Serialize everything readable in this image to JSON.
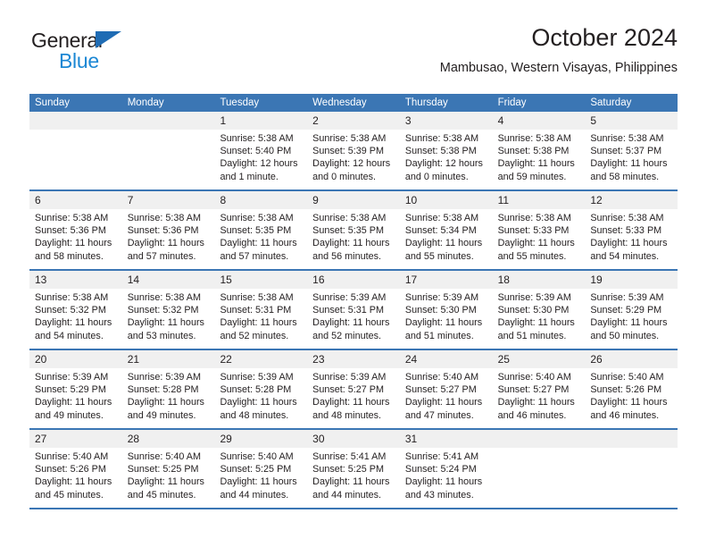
{
  "logo": {
    "word_general": "General",
    "word_blue": "Blue",
    "triangle_color": "#1f6cb4",
    "blue_color": "#1b87d4"
  },
  "header": {
    "title": "October 2024",
    "subtitle": "Mambusao, Western Visayas, Philippines"
  },
  "calendar": {
    "header_bg": "#3b76b4",
    "header_text_color": "#ffffff",
    "daynum_bg": "#f0f0f0",
    "weekdays": [
      "Sunday",
      "Monday",
      "Tuesday",
      "Wednesday",
      "Thursday",
      "Friday",
      "Saturday"
    ],
    "weeks": [
      [
        {
          "day": "",
          "lines": []
        },
        {
          "day": "",
          "lines": []
        },
        {
          "day": "1",
          "lines": [
            "Sunrise: 5:38 AM",
            "Sunset: 5:40 PM",
            "Daylight: 12 hours",
            "and 1 minute."
          ]
        },
        {
          "day": "2",
          "lines": [
            "Sunrise: 5:38 AM",
            "Sunset: 5:39 PM",
            "Daylight: 12 hours",
            "and 0 minutes."
          ]
        },
        {
          "day": "3",
          "lines": [
            "Sunrise: 5:38 AM",
            "Sunset: 5:38 PM",
            "Daylight: 12 hours",
            "and 0 minutes."
          ]
        },
        {
          "day": "4",
          "lines": [
            "Sunrise: 5:38 AM",
            "Sunset: 5:38 PM",
            "Daylight: 11 hours",
            "and 59 minutes."
          ]
        },
        {
          "day": "5",
          "lines": [
            "Sunrise: 5:38 AM",
            "Sunset: 5:37 PM",
            "Daylight: 11 hours",
            "and 58 minutes."
          ]
        }
      ],
      [
        {
          "day": "6",
          "lines": [
            "Sunrise: 5:38 AM",
            "Sunset: 5:36 PM",
            "Daylight: 11 hours",
            "and 58 minutes."
          ]
        },
        {
          "day": "7",
          "lines": [
            "Sunrise: 5:38 AM",
            "Sunset: 5:36 PM",
            "Daylight: 11 hours",
            "and 57 minutes."
          ]
        },
        {
          "day": "8",
          "lines": [
            "Sunrise: 5:38 AM",
            "Sunset: 5:35 PM",
            "Daylight: 11 hours",
            "and 57 minutes."
          ]
        },
        {
          "day": "9",
          "lines": [
            "Sunrise: 5:38 AM",
            "Sunset: 5:35 PM",
            "Daylight: 11 hours",
            "and 56 minutes."
          ]
        },
        {
          "day": "10",
          "lines": [
            "Sunrise: 5:38 AM",
            "Sunset: 5:34 PM",
            "Daylight: 11 hours",
            "and 55 minutes."
          ]
        },
        {
          "day": "11",
          "lines": [
            "Sunrise: 5:38 AM",
            "Sunset: 5:33 PM",
            "Daylight: 11 hours",
            "and 55 minutes."
          ]
        },
        {
          "day": "12",
          "lines": [
            "Sunrise: 5:38 AM",
            "Sunset: 5:33 PM",
            "Daylight: 11 hours",
            "and 54 minutes."
          ]
        }
      ],
      [
        {
          "day": "13",
          "lines": [
            "Sunrise: 5:38 AM",
            "Sunset: 5:32 PM",
            "Daylight: 11 hours",
            "and 54 minutes."
          ]
        },
        {
          "day": "14",
          "lines": [
            "Sunrise: 5:38 AM",
            "Sunset: 5:32 PM",
            "Daylight: 11 hours",
            "and 53 minutes."
          ]
        },
        {
          "day": "15",
          "lines": [
            "Sunrise: 5:38 AM",
            "Sunset: 5:31 PM",
            "Daylight: 11 hours",
            "and 52 minutes."
          ]
        },
        {
          "day": "16",
          "lines": [
            "Sunrise: 5:39 AM",
            "Sunset: 5:31 PM",
            "Daylight: 11 hours",
            "and 52 minutes."
          ]
        },
        {
          "day": "17",
          "lines": [
            "Sunrise: 5:39 AM",
            "Sunset: 5:30 PM",
            "Daylight: 11 hours",
            "and 51 minutes."
          ]
        },
        {
          "day": "18",
          "lines": [
            "Sunrise: 5:39 AM",
            "Sunset: 5:30 PM",
            "Daylight: 11 hours",
            "and 51 minutes."
          ]
        },
        {
          "day": "19",
          "lines": [
            "Sunrise: 5:39 AM",
            "Sunset: 5:29 PM",
            "Daylight: 11 hours",
            "and 50 minutes."
          ]
        }
      ],
      [
        {
          "day": "20",
          "lines": [
            "Sunrise: 5:39 AM",
            "Sunset: 5:29 PM",
            "Daylight: 11 hours",
            "and 49 minutes."
          ]
        },
        {
          "day": "21",
          "lines": [
            "Sunrise: 5:39 AM",
            "Sunset: 5:28 PM",
            "Daylight: 11 hours",
            "and 49 minutes."
          ]
        },
        {
          "day": "22",
          "lines": [
            "Sunrise: 5:39 AM",
            "Sunset: 5:28 PM",
            "Daylight: 11 hours",
            "and 48 minutes."
          ]
        },
        {
          "day": "23",
          "lines": [
            "Sunrise: 5:39 AM",
            "Sunset: 5:27 PM",
            "Daylight: 11 hours",
            "and 48 minutes."
          ]
        },
        {
          "day": "24",
          "lines": [
            "Sunrise: 5:40 AM",
            "Sunset: 5:27 PM",
            "Daylight: 11 hours",
            "and 47 minutes."
          ]
        },
        {
          "day": "25",
          "lines": [
            "Sunrise: 5:40 AM",
            "Sunset: 5:27 PM",
            "Daylight: 11 hours",
            "and 46 minutes."
          ]
        },
        {
          "day": "26",
          "lines": [
            "Sunrise: 5:40 AM",
            "Sunset: 5:26 PM",
            "Daylight: 11 hours",
            "and 46 minutes."
          ]
        }
      ],
      [
        {
          "day": "27",
          "lines": [
            "Sunrise: 5:40 AM",
            "Sunset: 5:26 PM",
            "Daylight: 11 hours",
            "and 45 minutes."
          ]
        },
        {
          "day": "28",
          "lines": [
            "Sunrise: 5:40 AM",
            "Sunset: 5:25 PM",
            "Daylight: 11 hours",
            "and 45 minutes."
          ]
        },
        {
          "day": "29",
          "lines": [
            "Sunrise: 5:40 AM",
            "Sunset: 5:25 PM",
            "Daylight: 11 hours",
            "and 44 minutes."
          ]
        },
        {
          "day": "30",
          "lines": [
            "Sunrise: 5:41 AM",
            "Sunset: 5:25 PM",
            "Daylight: 11 hours",
            "and 44 minutes."
          ]
        },
        {
          "day": "31",
          "lines": [
            "Sunrise: 5:41 AM",
            "Sunset: 5:24 PM",
            "Daylight: 11 hours",
            "and 43 minutes."
          ]
        },
        {
          "day": "",
          "lines": []
        },
        {
          "day": "",
          "lines": []
        }
      ]
    ]
  }
}
